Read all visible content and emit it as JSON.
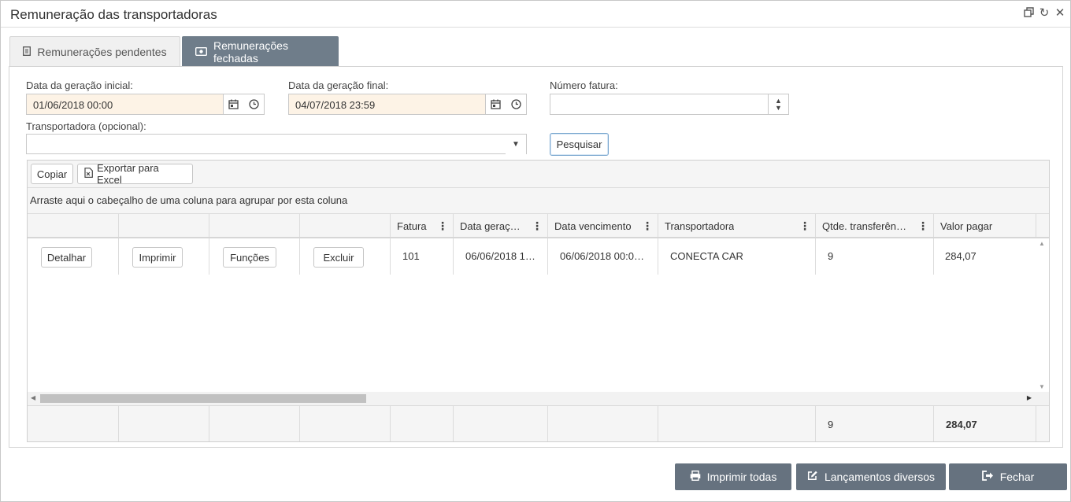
{
  "window": {
    "title": "Remuneração das transportadoras"
  },
  "tabs": [
    {
      "label": "Remunerações pendentes",
      "icon": "document-icon"
    },
    {
      "label": "Remunerações fechadas",
      "icon": "money-icon"
    }
  ],
  "filters": {
    "date_start_label": "Data da geração inicial:",
    "date_start_value": "01/06/2018 00:00",
    "date_end_label": "Data da geração final:",
    "date_end_value": "04/07/2018 23:59",
    "invoice_label": "Número fatura:",
    "invoice_value": "",
    "carrier_label": "Transportadora (opcional):",
    "carrier_value": "",
    "search_button": "Pesquisar"
  },
  "grid": {
    "toolbar": {
      "copy": "Copiar",
      "export": "Exportar para Excel"
    },
    "group_hint": "Arraste aqui o cabeçalho de uma coluna para agrupar por esta coluna",
    "columns": [
      "",
      "",
      "",
      "",
      "Fatura",
      "Data geraç…",
      "Data vencimento",
      "Transportadora",
      "Qtde. transferên…",
      "Valor pagar"
    ],
    "row": {
      "buttons": [
        "Detalhar",
        "Imprimir",
        "Funções",
        "Excluir"
      ],
      "fatura": "101",
      "data_geracao": "06/06/2018 1…",
      "data_vencimento": "06/06/2018 00:0…",
      "transportadora": "CONECTA CAR",
      "qtde": "9",
      "valor": "284,07"
    },
    "footer": {
      "qtde_total": "9",
      "valor_total": "284,07"
    }
  },
  "actions": {
    "print_all": "Imprimir todas",
    "misc_entries": "Lançamentos diversos",
    "close": "Fechar"
  }
}
